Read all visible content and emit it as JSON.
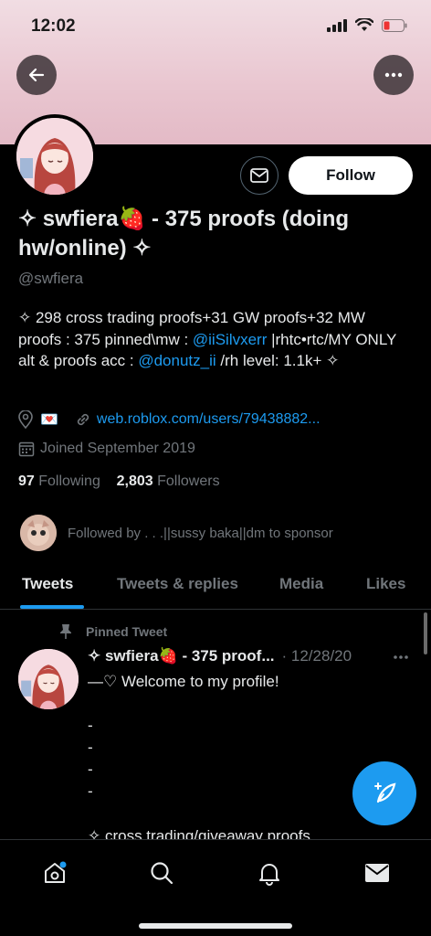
{
  "status_bar": {
    "time": "12:02"
  },
  "profile": {
    "display_name": "✧ swfiera🍓 - 375 proofs (doing hw/online) ✧",
    "handle": "@swfiera",
    "follow_label": "Follow",
    "bio": {
      "part1": "✧ 298 cross trading proofs+31 GW proofs+32 MW proofs : 375 pinned\\mw : ",
      "mention1": "@iiSilvxerr",
      "part2": " |rhtc•rtc/MY ONLY alt & proofs acc : ",
      "mention2": "@donutz_ii",
      "part3": " /rh level: 1.1k+ ✧"
    },
    "location_emoji": "💌",
    "website": "web.roblox.com/users/79438882...",
    "joined": "Joined September 2019",
    "following_count": "97",
    "following_label": "Following",
    "followers_count": "2,803",
    "followers_label": "Followers",
    "followed_by": "Followed by . . .||sussy baka||dm to sponsor"
  },
  "tabs": [
    {
      "label": "Tweets",
      "active": true
    },
    {
      "label": "Tweets & replies",
      "active": false
    },
    {
      "label": "Media",
      "active": false
    },
    {
      "label": "Likes",
      "active": false
    }
  ],
  "tweet": {
    "pinned_label": "Pinned Tweet",
    "name": "✧ swfiera🍓 - 375 proof...",
    "date": "· 12/28/20",
    "line1": "—♡ Welcome to my profile!",
    "dashes": [
      "-",
      "-",
      "-",
      "-"
    ],
    "cut_line": "✧ cross trading/giveaway proofs"
  },
  "colors": {
    "accent": "#1d9bf0",
    "banner": "#e9c6d0",
    "background": "#000000"
  }
}
